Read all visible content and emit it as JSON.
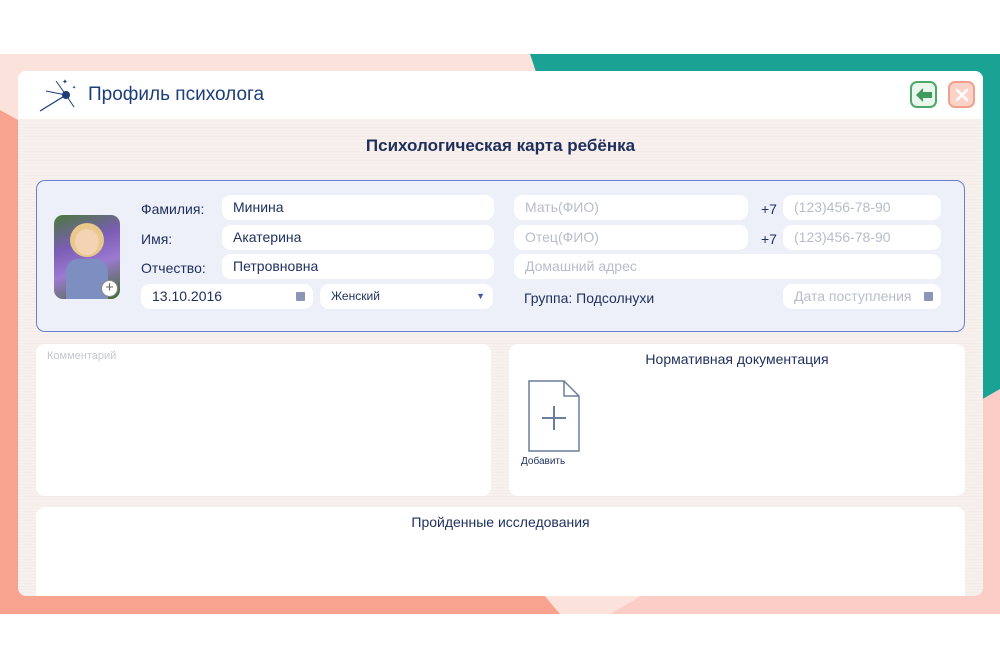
{
  "app": {
    "title": "Профиль психолога"
  },
  "page": {
    "heading": "Психологическая карта ребёнка"
  },
  "child": {
    "surname_label": "Фамилия:",
    "surname": "Минина",
    "name_label": "Имя:",
    "name": "Акатерина",
    "patronymic_label": "Отчество:",
    "patronymic": "Петровновна",
    "birth_date": "13.10.2016",
    "gender": "Женский"
  },
  "contacts": {
    "mother_placeholder": "Мать(ФИО)",
    "father_placeholder": "Отец(ФИО)",
    "phone_prefix": "+7",
    "phone_placeholder": "(123)456-78-90",
    "address_placeholder": "Домашний адрес",
    "group_text": "Группа: Подсолнухи",
    "admission_placeholder": "Дата поступления"
  },
  "comment": {
    "placeholder": "Комментарий"
  },
  "documents": {
    "title": "Нормативная документация",
    "add_label": "Добавить"
  },
  "research": {
    "title": "Пройденные исследования"
  },
  "colors": {
    "accent": "#1e2f5c",
    "card_border": "#6b7fcb",
    "teal": "#1aa394",
    "salmon": "#f7a390"
  },
  "icons": {
    "back": "arrow-left-icon",
    "close": "close-icon",
    "add_document": "document-add-icon",
    "calendar": "calendar-icon",
    "add_photo": "plus-icon",
    "logo": "sputnik-logo-icon"
  }
}
